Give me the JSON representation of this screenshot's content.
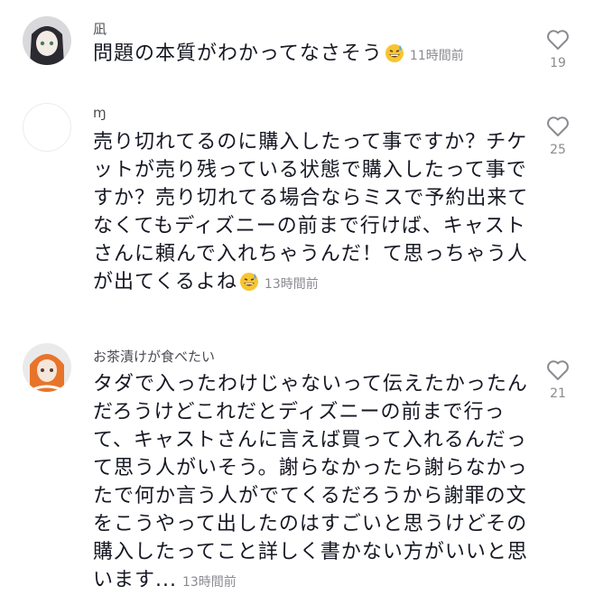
{
  "comments": [
    {
      "username": "凪",
      "text": "問題の本質がわかってなさそう",
      "emoji": "grinning-sweat-emoji",
      "time": "11時間前",
      "likes": "19"
    },
    {
      "username": "ɱ",
      "text": "売り切れてるのに購入したって事ですか？チケットが売り残っている状態で購入したって事ですか？売り切れてる場合ならミスで予約出来てなくてもディズニーの前まで行けば、キャストさんに頼んで入れちゃうんだ！て思っちゃう人が出てくるよね",
      "emoji": "grinning-sweat-emoji",
      "time": "13時間前",
      "likes": "25"
    },
    {
      "username": "お茶漬けが食べたい",
      "text": "タダで入ったわけじゃないって伝えたかったんだろうけどこれだとディズニーの前まで行って、キャストさんに言えば買って入れるんだって思う人がいそう。謝らなかったら謝らなかったで何か言う人がでてくるだろうから謝罪の文をこうやって出したのはすごいと思うけどその購入したってこと詳しく書かない方がいいと思います...",
      "time": "13時間前",
      "likes": "21"
    }
  ],
  "colors": {
    "text": "#161823",
    "muted": "#8a8b91",
    "heart": "#8a8b91"
  }
}
